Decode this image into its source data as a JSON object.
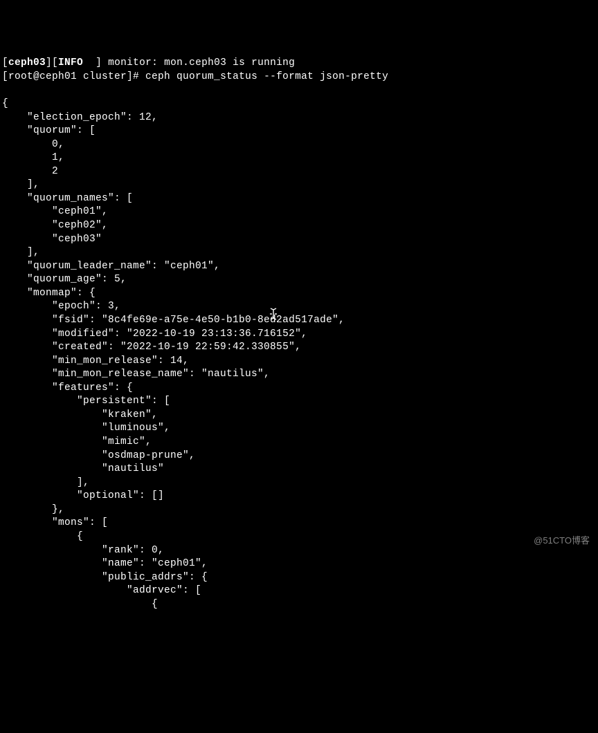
{
  "header": {
    "line1_prefix": "ceph03",
    "line1_open": "][",
    "line1_info": "INFO",
    "line1_close": "  ] monitor: mon.ceph03 is running",
    "prompt": "[root@ceph01 cluster]# ",
    "command": "ceph quorum_status --format json-pretty"
  },
  "json_output": {
    "open_brace": "{",
    "election_epoch_line": "    \"election_epoch\": 12,",
    "quorum_open": "    \"quorum\": [",
    "quorum_0": "        0,",
    "quorum_1": "        1,",
    "quorum_2": "        2",
    "quorum_close": "    ],",
    "quorum_names_open": "    \"quorum_names\": [",
    "quorum_names_0": "        \"ceph01\",",
    "quorum_names_1": "        \"ceph02\",",
    "quorum_names_2": "        \"ceph03\"",
    "quorum_names_close": "    ],",
    "quorum_leader": "    \"quorum_leader_name\": \"ceph01\",",
    "quorum_age": "    \"quorum_age\": 5,",
    "monmap_open": "    \"monmap\": {",
    "monmap_epoch": "        \"epoch\": 3,",
    "monmap_fsid": "        \"fsid\": \"8c4fe69e-a75e-4e50-b1b0-8ed2ad517ade\",",
    "monmap_modified": "        \"modified\": \"2022-10-19 23:13:36.716152\",",
    "monmap_created": "        \"created\": \"2022-10-19 22:59:42.330855\",",
    "monmap_min_mon_release": "        \"min_mon_release\": 14,",
    "monmap_min_mon_release_name": "        \"min_mon_release_name\": \"nautilus\",",
    "features_open": "        \"features\": {",
    "persistent_open": "            \"persistent\": [",
    "persistent_0": "                \"kraken\",",
    "persistent_1": "                \"luminous\",",
    "persistent_2": "                \"mimic\",",
    "persistent_3": "                \"osdmap-prune\",",
    "persistent_4": "                \"nautilus\"",
    "persistent_close": "            ],",
    "optional_line": "            \"optional\": []",
    "features_close": "        },",
    "mons_open": "        \"mons\": [",
    "mons_item_open": "            {",
    "mons_rank": "                \"rank\": 0,",
    "mons_name": "                \"name\": \"ceph01\",",
    "public_addrs_open": "                \"public_addrs\": {",
    "addrvec_open": "                    \"addrvec\": [",
    "addrvec_item_open": "                        {"
  },
  "watermark": "@51CTO博客"
}
